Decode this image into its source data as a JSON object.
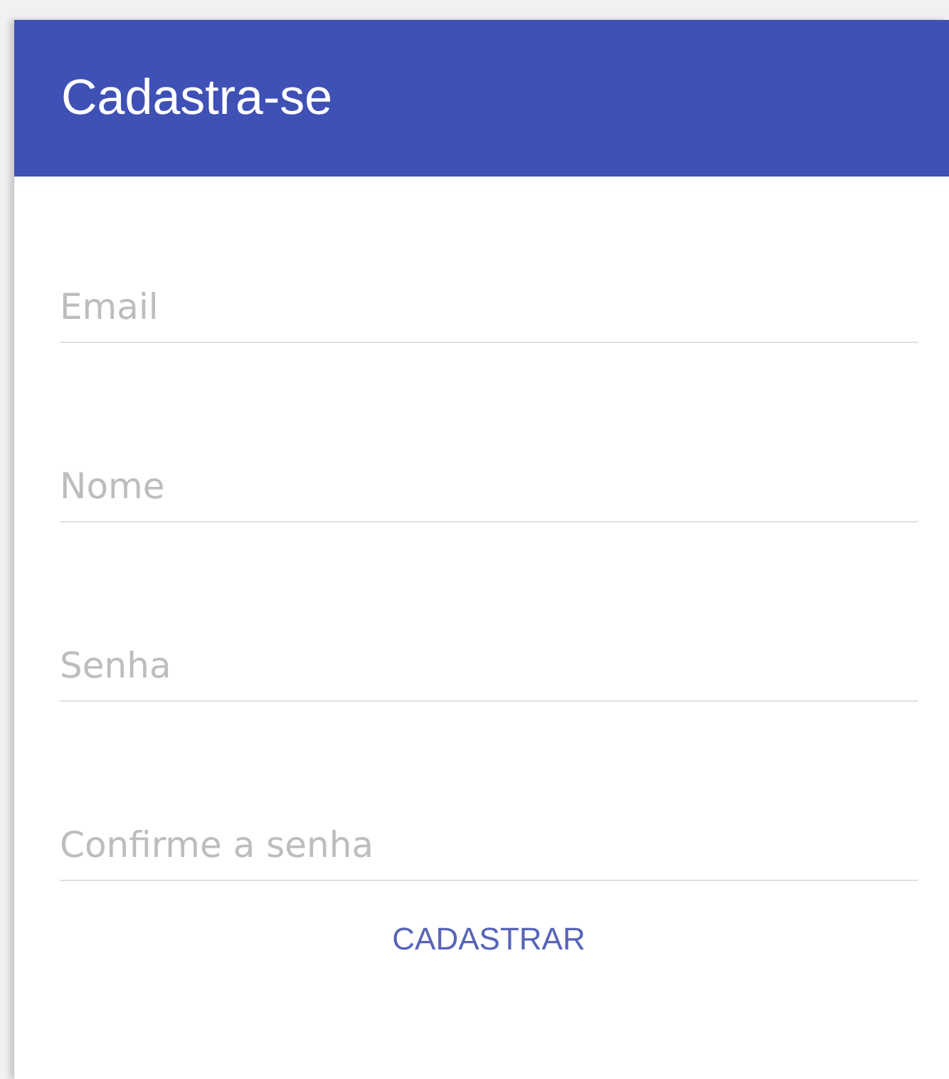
{
  "header": {
    "title": "Cadastra-se"
  },
  "fields": [
    {
      "placeholder": "Email"
    },
    {
      "placeholder": "Nome"
    },
    {
      "placeholder": "Senha"
    },
    {
      "placeholder": "Confirme a senha"
    }
  ],
  "button": {
    "label": "CADASTRAR"
  }
}
